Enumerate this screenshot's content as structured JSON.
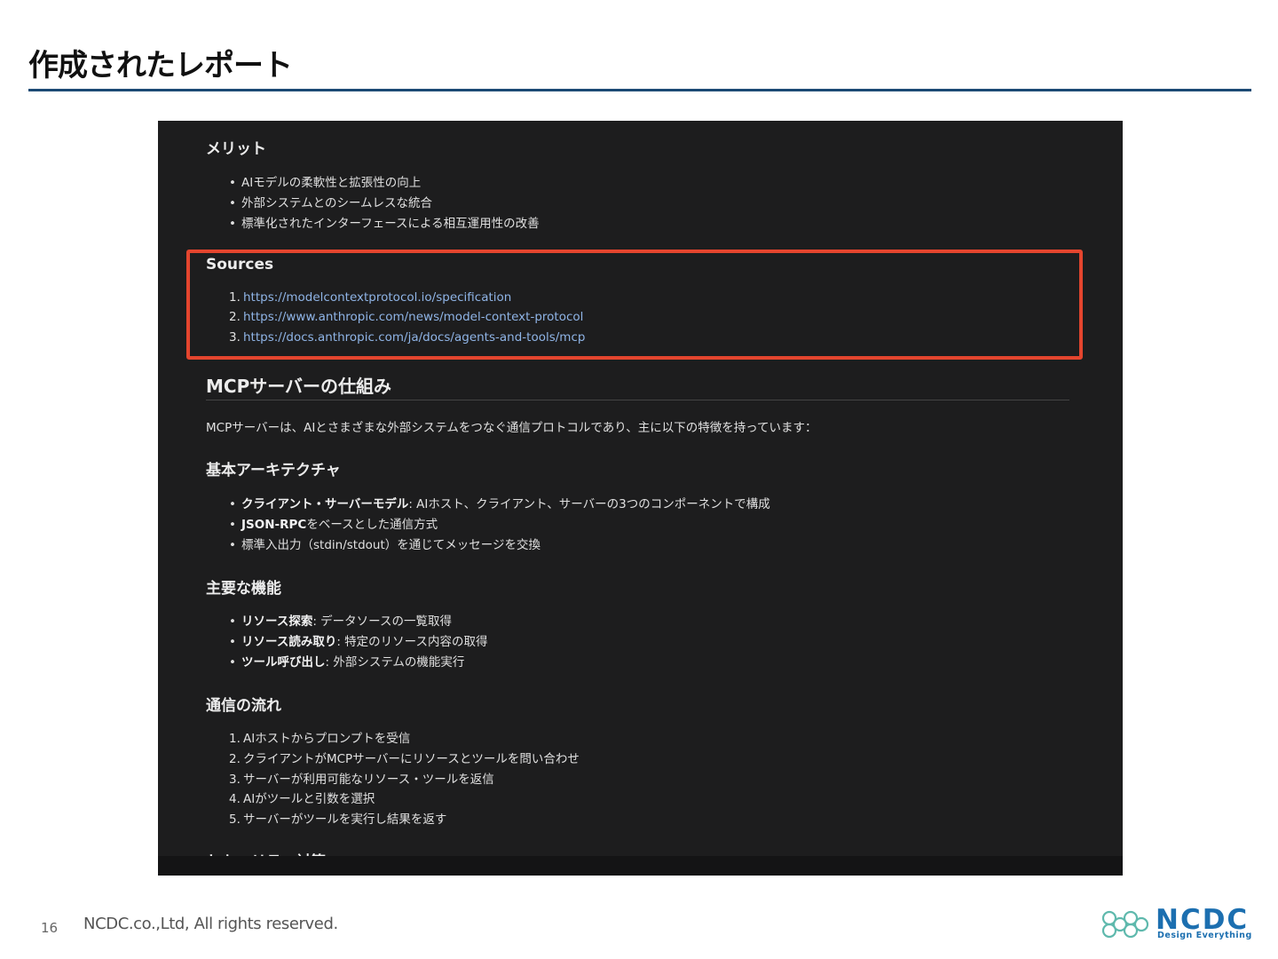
{
  "slide": {
    "title": "作成されたレポート",
    "page_number": "16",
    "copyright": "NCDC.co.,Ltd, All rights reserved.",
    "logo_text": "NCDC",
    "logo_tagline": "Design Everything"
  },
  "report": {
    "merit": {
      "heading": "メリット",
      "items": [
        "AIモデルの柔軟性と拡張性の向上",
        "外部システムとのシームレスな統合",
        "標準化されたインターフェースによる相互運用性の改善"
      ]
    },
    "sources": {
      "heading": "Sources",
      "links": [
        {
          "num": "1.",
          "url": "https://modelcontextprotocol.io/specification"
        },
        {
          "num": "2.",
          "url": "https://www.anthropic.com/news/model-context-protocol"
        },
        {
          "num": "3.",
          "url": "https://docs.anthropic.com/ja/docs/agents-and-tools/mcp"
        }
      ]
    },
    "mechanism": {
      "heading": "MCPサーバーの仕組み",
      "intro": "MCPサーバーは、AIとさまざまな外部システムをつなぐ通信プロトコルであり、主に以下の特徴を持っています："
    },
    "architecture": {
      "heading": "基本アーキテクチャ",
      "items": [
        {
          "bold": "クライアント・サーバーモデル",
          "text": ": AIホスト、クライアント、サーバーの3つのコンポーネントで構成"
        },
        {
          "bold": "JSON-RPC",
          "text": "をベースとした通信方式"
        },
        {
          "bold": "",
          "text": "標準入出力（stdin/stdout）を通じてメッセージを交換"
        }
      ]
    },
    "features": {
      "heading": "主要な機能",
      "items": [
        {
          "bold": "リソース探索",
          "text": ": データソースの一覧取得"
        },
        {
          "bold": "リソース読み取り",
          "text": ": 特定のリソース内容の取得"
        },
        {
          "bold": "ツール呼び出し",
          "text": ": 外部システムの機能実行"
        }
      ]
    },
    "flow": {
      "heading": "通信の流れ",
      "steps": [
        {
          "num": "1.",
          "text": "AIホストからプロンプトを受信"
        },
        {
          "num": "2.",
          "text": "クライアントがMCPサーバーにリソースとツールを問い合わせ"
        },
        {
          "num": "3.",
          "text": "サーバーが利用可能なリソース・ツールを返信"
        },
        {
          "num": "4.",
          "text": "AIがツールと引数を選択"
        },
        {
          "num": "5.",
          "text": "サーバーがツールを実行し結果を返す"
        }
      ]
    },
    "cutoff_heading": "セキュリティ対策"
  }
}
